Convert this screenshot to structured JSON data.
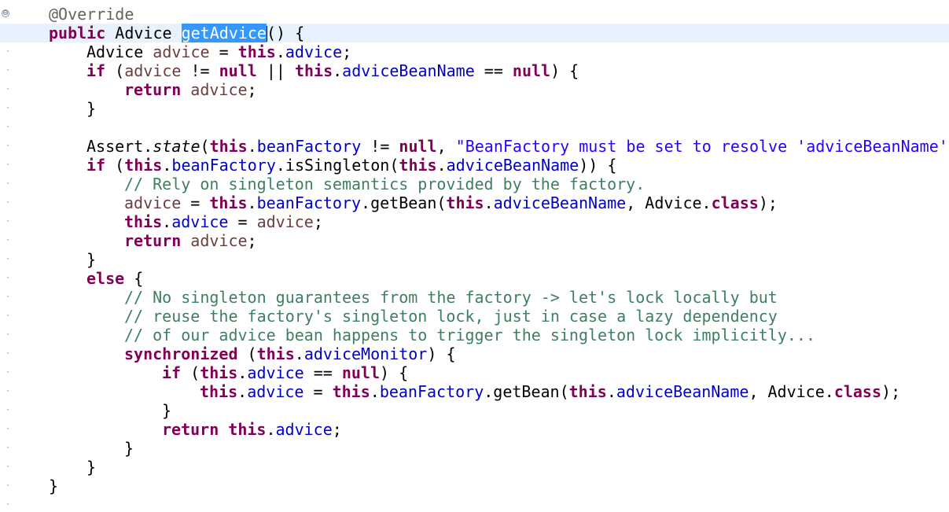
{
  "editor": {
    "gutter_fold_label": "⊖",
    "lines": [
      {
        "indent": 1,
        "tokens": [
          [
            "ann",
            "@Override"
          ]
        ]
      },
      {
        "indent": 1,
        "current": true,
        "tokens": [
          [
            "kw",
            "public"
          ],
          [
            "",
            " Advice "
          ],
          [
            "sel",
            "getAdvice"
          ],
          [
            "caret",
            ""
          ],
          [
            "",
            "() {"
          ]
        ]
      },
      {
        "indent": 2,
        "tokens": [
          [
            "",
            "Advice "
          ],
          [
            "var",
            "advice"
          ],
          [
            "",
            " = "
          ],
          [
            "kw",
            "this"
          ],
          [
            "",
            "."
          ],
          [
            "fld",
            "advice"
          ],
          [
            "",
            ";"
          ]
        ]
      },
      {
        "indent": 2,
        "tokens": [
          [
            "kw",
            "if"
          ],
          [
            "",
            " ("
          ],
          [
            "var",
            "advice"
          ],
          [
            "",
            " != "
          ],
          [
            "kw",
            "null"
          ],
          [
            "",
            " || "
          ],
          [
            "kw",
            "this"
          ],
          [
            "",
            "."
          ],
          [
            "fld",
            "adviceBeanName"
          ],
          [
            "",
            " == "
          ],
          [
            "kw",
            "null"
          ],
          [
            "",
            ") {"
          ]
        ]
      },
      {
        "indent": 3,
        "tokens": [
          [
            "kw",
            "return"
          ],
          [
            "",
            " "
          ],
          [
            "var",
            "advice"
          ],
          [
            "",
            ";"
          ]
        ]
      },
      {
        "indent": 2,
        "tokens": [
          [
            "",
            "}"
          ]
        ]
      },
      {
        "indent": 0,
        "tokens": [
          [
            "",
            ""
          ]
        ]
      },
      {
        "indent": 2,
        "tokens": [
          [
            "",
            "Assert."
          ],
          [
            "ital",
            "state"
          ],
          [
            "",
            "("
          ],
          [
            "kw",
            "this"
          ],
          [
            "",
            "."
          ],
          [
            "fld",
            "beanFactory"
          ],
          [
            "",
            " != "
          ],
          [
            "kw",
            "null"
          ],
          [
            "",
            ", "
          ],
          [
            "str",
            "\"BeanFactory must be set to resolve 'adviceBeanName'\""
          ]
        ]
      },
      {
        "indent": 2,
        "tokens": [
          [
            "kw",
            "if"
          ],
          [
            "",
            " ("
          ],
          [
            "kw",
            "this"
          ],
          [
            "",
            "."
          ],
          [
            "fld",
            "beanFactory"
          ],
          [
            "",
            ".isSingleton("
          ],
          [
            "kw",
            "this"
          ],
          [
            "",
            "."
          ],
          [
            "fld",
            "adviceBeanName"
          ],
          [
            "",
            ")) {"
          ]
        ]
      },
      {
        "indent": 3,
        "tokens": [
          [
            "cmt",
            "// Rely on singleton semantics provided by the factory."
          ]
        ]
      },
      {
        "indent": 3,
        "tokens": [
          [
            "var",
            "advice"
          ],
          [
            "",
            " = "
          ],
          [
            "kw",
            "this"
          ],
          [
            "",
            "."
          ],
          [
            "fld",
            "beanFactory"
          ],
          [
            "",
            ".getBean("
          ],
          [
            "kw",
            "this"
          ],
          [
            "",
            "."
          ],
          [
            "fld",
            "adviceBeanName"
          ],
          [
            "",
            ", Advice."
          ],
          [
            "kw",
            "class"
          ],
          [
            "",
            ");"
          ]
        ]
      },
      {
        "indent": 3,
        "tokens": [
          [
            "kw",
            "this"
          ],
          [
            "",
            "."
          ],
          [
            "fld",
            "advice"
          ],
          [
            "",
            " = "
          ],
          [
            "var",
            "advice"
          ],
          [
            "",
            ";"
          ]
        ]
      },
      {
        "indent": 3,
        "tokens": [
          [
            "kw",
            "return"
          ],
          [
            "",
            " "
          ],
          [
            "var",
            "advice"
          ],
          [
            "",
            ";"
          ]
        ]
      },
      {
        "indent": 2,
        "tokens": [
          [
            "",
            "}"
          ]
        ]
      },
      {
        "indent": 2,
        "tokens": [
          [
            "kw",
            "else"
          ],
          [
            "",
            " {"
          ]
        ]
      },
      {
        "indent": 3,
        "tokens": [
          [
            "cmt",
            "// No singleton guarantees from the factory -> let's lock locally but"
          ]
        ]
      },
      {
        "indent": 3,
        "tokens": [
          [
            "cmt",
            "// reuse the factory's singleton lock, just in case a lazy dependency"
          ]
        ]
      },
      {
        "indent": 3,
        "tokens": [
          [
            "cmt",
            "// of our advice bean happens to trigger the singleton lock implicitly..."
          ]
        ]
      },
      {
        "indent": 3,
        "tokens": [
          [
            "kw",
            "synchronized"
          ],
          [
            "",
            " ("
          ],
          [
            "kw",
            "this"
          ],
          [
            "",
            "."
          ],
          [
            "fld",
            "adviceMonitor"
          ],
          [
            "",
            ") {"
          ]
        ]
      },
      {
        "indent": 4,
        "tokens": [
          [
            "kw",
            "if"
          ],
          [
            "",
            " ("
          ],
          [
            "kw",
            "this"
          ],
          [
            "",
            "."
          ],
          [
            "fld",
            "advice"
          ],
          [
            "",
            " == "
          ],
          [
            "kw",
            "null"
          ],
          [
            "",
            ") {"
          ]
        ]
      },
      {
        "indent": 5,
        "tokens": [
          [
            "kw",
            "this"
          ],
          [
            "",
            "."
          ],
          [
            "fld",
            "advice"
          ],
          [
            "",
            " = "
          ],
          [
            "kw",
            "this"
          ],
          [
            "",
            "."
          ],
          [
            "fld",
            "beanFactory"
          ],
          [
            "",
            ".getBean("
          ],
          [
            "kw",
            "this"
          ],
          [
            "",
            "."
          ],
          [
            "fld",
            "adviceBeanName"
          ],
          [
            "",
            ", Advice."
          ],
          [
            "kw",
            "class"
          ],
          [
            "",
            ");"
          ]
        ]
      },
      {
        "indent": 4,
        "tokens": [
          [
            "",
            "}"
          ]
        ]
      },
      {
        "indent": 4,
        "tokens": [
          [
            "kw",
            "return"
          ],
          [
            "",
            " "
          ],
          [
            "kw",
            "this"
          ],
          [
            "",
            "."
          ],
          [
            "fld",
            "advice"
          ],
          [
            "",
            ";"
          ]
        ]
      },
      {
        "indent": 3,
        "tokens": [
          [
            "",
            "}"
          ]
        ]
      },
      {
        "indent": 2,
        "tokens": [
          [
            "",
            "}"
          ]
        ]
      },
      {
        "indent": 1,
        "tokens": [
          [
            "",
            "}"
          ]
        ]
      }
    ]
  }
}
